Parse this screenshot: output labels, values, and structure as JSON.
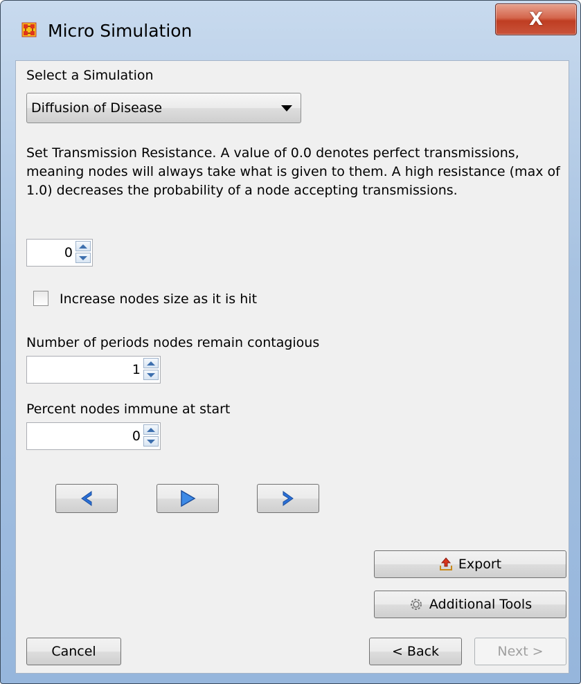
{
  "window": {
    "title": "Micro Simulation",
    "close_label": "X"
  },
  "simulation": {
    "select_label": "Select a Simulation",
    "selected_value": "Diffusion of Disease"
  },
  "transmission": {
    "description": "Set Transmission Resistance. A value of 0.0 denotes perfect transmissions, meaning nodes will always take what is given to them. A high resistance (max of 1.0) decreases the probability of a node accepting transmissions.",
    "value": "0"
  },
  "increase_size": {
    "label": "Increase nodes size as it is hit",
    "checked": false
  },
  "contagious": {
    "label": "Number of periods nodes remain contagious",
    "value": "1"
  },
  "immune": {
    "label": "Percent nodes immune at start",
    "value": "0"
  },
  "playback": {
    "icons": [
      "previous-icon",
      "play-icon",
      "next-step-icon"
    ],
    "accent_color": "#2a6fd6"
  },
  "actions": {
    "export_label": "Export",
    "additional_tools_label": "Additional Tools"
  },
  "footer": {
    "cancel_label": "Cancel",
    "back_label": "< Back",
    "next_label": "Next >"
  }
}
